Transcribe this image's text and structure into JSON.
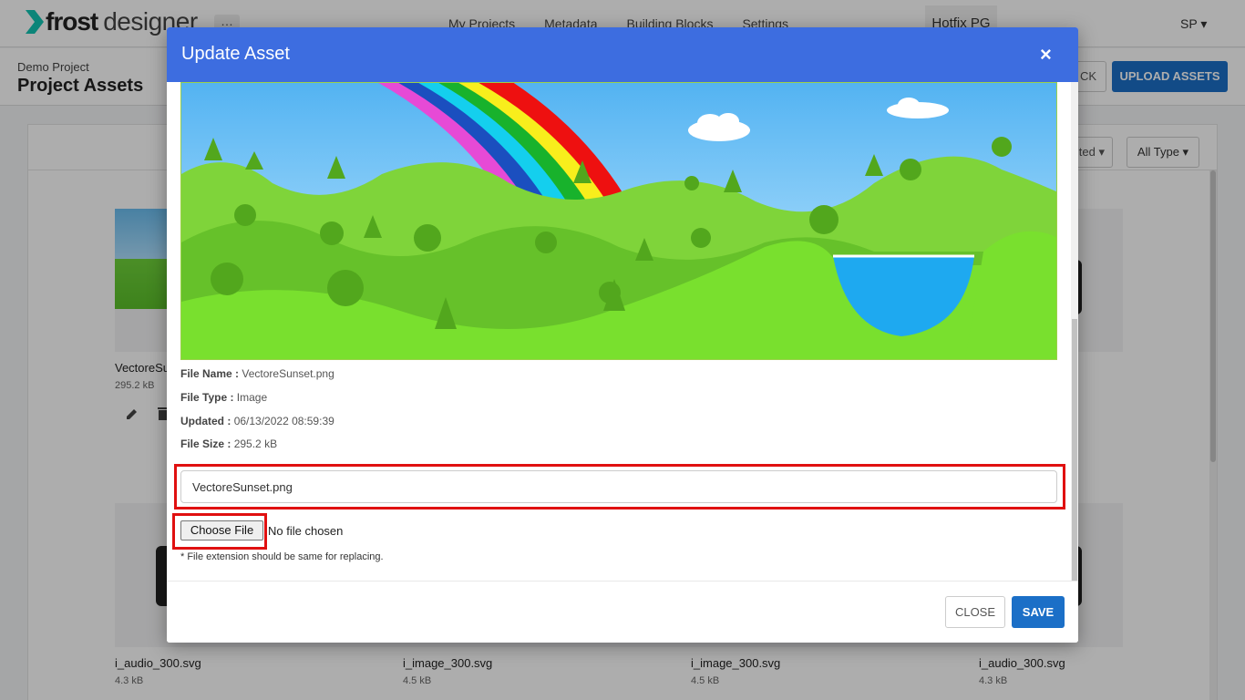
{
  "brand": {
    "name_bold": "frost",
    "name_light": "designer"
  },
  "nav": {
    "more": "…",
    "links": [
      "My Projects",
      "Metadata",
      "Building Blocks",
      "Settings"
    ],
    "workspace": "Hotfix PG",
    "user": "SP ▾"
  },
  "subheader": {
    "project": "Demo Project",
    "title": "Project Assets",
    "back_label": "CK",
    "upload_label": "UPLOAD ASSETS"
  },
  "filters": {
    "sort_label": "ted ▾",
    "type_label": "All Type ▾"
  },
  "assets": [
    {
      "name": "VectoreSu",
      "size": "295.2 kB"
    },
    {
      "name": "i_audio_300.svg",
      "size": "4.3 kB"
    },
    {
      "name": "i_image_300.svg",
      "size": "4.5 kB"
    },
    {
      "name": "i_image_300.svg",
      "size": "4.5 kB"
    },
    {
      "name": "i_audio_300.svg",
      "size": "4.3 kB"
    }
  ],
  "modal": {
    "title": "Update Asset",
    "close_icon": "×",
    "file_name_label": "File Name :",
    "file_name": "VectoreSunset.png",
    "file_type_label": "File Type :",
    "file_type": "Image",
    "updated_label": "Updated :",
    "updated": "06/13/2022 08:59:39",
    "file_size_label": "File Size :",
    "file_size": "295.2 kB",
    "name_input_value": "VectoreSunset.png",
    "choose_file_label": "Choose File",
    "no_file_text": "No file chosen",
    "note": "* File extension should be same for replacing.",
    "close_label": "CLOSE",
    "save_label": "SAVE"
  },
  "colors": {
    "header": "#3d6de0",
    "primary": "#1b6fc7",
    "highlight": "#e01010"
  }
}
